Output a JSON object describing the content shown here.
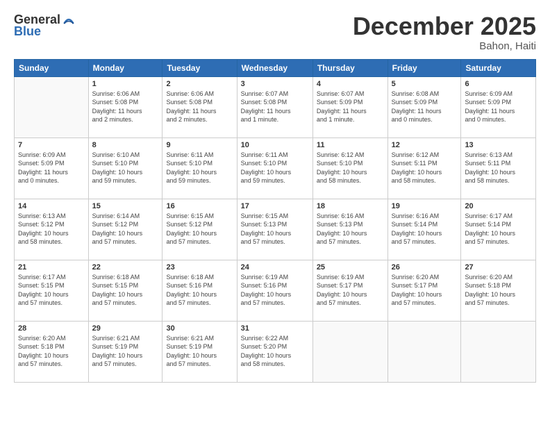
{
  "header": {
    "logo_general": "General",
    "logo_blue": "Blue",
    "month_title": "December 2025",
    "location": "Bahon, Haiti"
  },
  "days_of_week": [
    "Sunday",
    "Monday",
    "Tuesday",
    "Wednesday",
    "Thursday",
    "Friday",
    "Saturday"
  ],
  "weeks": [
    [
      {
        "day": "",
        "info": ""
      },
      {
        "day": "1",
        "info": "Sunrise: 6:06 AM\nSunset: 5:08 PM\nDaylight: 11 hours\nand 2 minutes."
      },
      {
        "day": "2",
        "info": "Sunrise: 6:06 AM\nSunset: 5:08 PM\nDaylight: 11 hours\nand 2 minutes."
      },
      {
        "day": "3",
        "info": "Sunrise: 6:07 AM\nSunset: 5:08 PM\nDaylight: 11 hours\nand 1 minute."
      },
      {
        "day": "4",
        "info": "Sunrise: 6:07 AM\nSunset: 5:09 PM\nDaylight: 11 hours\nand 1 minute."
      },
      {
        "day": "5",
        "info": "Sunrise: 6:08 AM\nSunset: 5:09 PM\nDaylight: 11 hours\nand 0 minutes."
      },
      {
        "day": "6",
        "info": "Sunrise: 6:09 AM\nSunset: 5:09 PM\nDaylight: 11 hours\nand 0 minutes."
      }
    ],
    [
      {
        "day": "7",
        "info": "Sunrise: 6:09 AM\nSunset: 5:09 PM\nDaylight: 11 hours\nand 0 minutes."
      },
      {
        "day": "8",
        "info": "Sunrise: 6:10 AM\nSunset: 5:10 PM\nDaylight: 10 hours\nand 59 minutes."
      },
      {
        "day": "9",
        "info": "Sunrise: 6:11 AM\nSunset: 5:10 PM\nDaylight: 10 hours\nand 59 minutes."
      },
      {
        "day": "10",
        "info": "Sunrise: 6:11 AM\nSunset: 5:10 PM\nDaylight: 10 hours\nand 59 minutes."
      },
      {
        "day": "11",
        "info": "Sunrise: 6:12 AM\nSunset: 5:10 PM\nDaylight: 10 hours\nand 58 minutes."
      },
      {
        "day": "12",
        "info": "Sunrise: 6:12 AM\nSunset: 5:11 PM\nDaylight: 10 hours\nand 58 minutes."
      },
      {
        "day": "13",
        "info": "Sunrise: 6:13 AM\nSunset: 5:11 PM\nDaylight: 10 hours\nand 58 minutes."
      }
    ],
    [
      {
        "day": "14",
        "info": "Sunrise: 6:13 AM\nSunset: 5:12 PM\nDaylight: 10 hours\nand 58 minutes."
      },
      {
        "day": "15",
        "info": "Sunrise: 6:14 AM\nSunset: 5:12 PM\nDaylight: 10 hours\nand 57 minutes."
      },
      {
        "day": "16",
        "info": "Sunrise: 6:15 AM\nSunset: 5:12 PM\nDaylight: 10 hours\nand 57 minutes."
      },
      {
        "day": "17",
        "info": "Sunrise: 6:15 AM\nSunset: 5:13 PM\nDaylight: 10 hours\nand 57 minutes."
      },
      {
        "day": "18",
        "info": "Sunrise: 6:16 AM\nSunset: 5:13 PM\nDaylight: 10 hours\nand 57 minutes."
      },
      {
        "day": "19",
        "info": "Sunrise: 6:16 AM\nSunset: 5:14 PM\nDaylight: 10 hours\nand 57 minutes."
      },
      {
        "day": "20",
        "info": "Sunrise: 6:17 AM\nSunset: 5:14 PM\nDaylight: 10 hours\nand 57 minutes."
      }
    ],
    [
      {
        "day": "21",
        "info": "Sunrise: 6:17 AM\nSunset: 5:15 PM\nDaylight: 10 hours\nand 57 minutes."
      },
      {
        "day": "22",
        "info": "Sunrise: 6:18 AM\nSunset: 5:15 PM\nDaylight: 10 hours\nand 57 minutes."
      },
      {
        "day": "23",
        "info": "Sunrise: 6:18 AM\nSunset: 5:16 PM\nDaylight: 10 hours\nand 57 minutes."
      },
      {
        "day": "24",
        "info": "Sunrise: 6:19 AM\nSunset: 5:16 PM\nDaylight: 10 hours\nand 57 minutes."
      },
      {
        "day": "25",
        "info": "Sunrise: 6:19 AM\nSunset: 5:17 PM\nDaylight: 10 hours\nand 57 minutes."
      },
      {
        "day": "26",
        "info": "Sunrise: 6:20 AM\nSunset: 5:17 PM\nDaylight: 10 hours\nand 57 minutes."
      },
      {
        "day": "27",
        "info": "Sunrise: 6:20 AM\nSunset: 5:18 PM\nDaylight: 10 hours\nand 57 minutes."
      }
    ],
    [
      {
        "day": "28",
        "info": "Sunrise: 6:20 AM\nSunset: 5:18 PM\nDaylight: 10 hours\nand 57 minutes."
      },
      {
        "day": "29",
        "info": "Sunrise: 6:21 AM\nSunset: 5:19 PM\nDaylight: 10 hours\nand 57 minutes."
      },
      {
        "day": "30",
        "info": "Sunrise: 6:21 AM\nSunset: 5:19 PM\nDaylight: 10 hours\nand 57 minutes."
      },
      {
        "day": "31",
        "info": "Sunrise: 6:22 AM\nSunset: 5:20 PM\nDaylight: 10 hours\nand 58 minutes."
      },
      {
        "day": "",
        "info": ""
      },
      {
        "day": "",
        "info": ""
      },
      {
        "day": "",
        "info": ""
      }
    ]
  ]
}
